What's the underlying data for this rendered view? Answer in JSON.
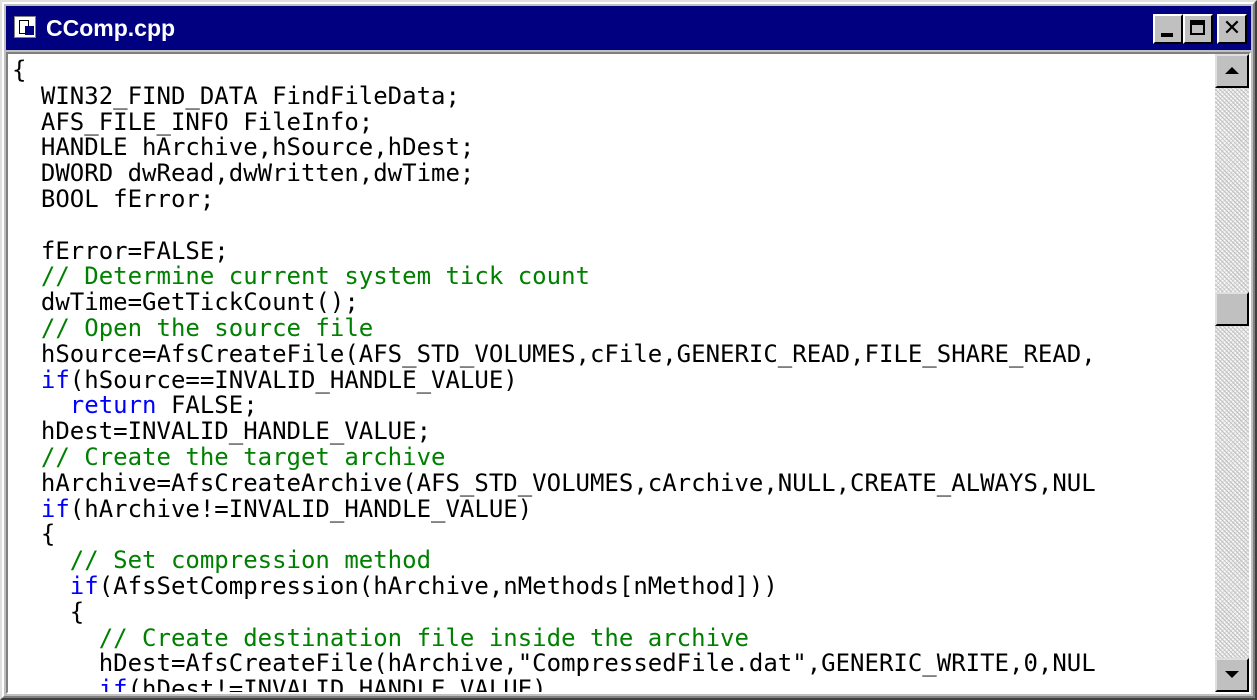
{
  "window": {
    "title": "CComp.cpp",
    "icon": "document-icon",
    "controls": {
      "minimize": "minimize-icon",
      "maximize": "maximize-icon",
      "close": "close-icon",
      "close_glyph": "✕"
    }
  },
  "colors": {
    "titlebar": "#000080",
    "comment": "#008000",
    "keyword": "#0000ff",
    "text": "#000000"
  },
  "editor": {
    "lines": [
      [
        {
          "t": "plain",
          "v": "{"
        }
      ],
      [
        {
          "t": "plain",
          "v": "  WIN32_FIND_DATA FindFileData;"
        }
      ],
      [
        {
          "t": "plain",
          "v": "  AFS_FILE_INFO FileInfo;"
        }
      ],
      [
        {
          "t": "plain",
          "v": "  HANDLE hArchive,hSource,hDest;"
        }
      ],
      [
        {
          "t": "plain",
          "v": "  DWORD dwRead,dwWritten,dwTime;"
        }
      ],
      [
        {
          "t": "plain",
          "v": "  BOOL fError;"
        }
      ],
      [
        {
          "t": "plain",
          "v": ""
        }
      ],
      [
        {
          "t": "plain",
          "v": "  fError=FALSE;"
        }
      ],
      [
        {
          "t": "comment",
          "v": "  // Determine current system tick count"
        }
      ],
      [
        {
          "t": "plain",
          "v": "  dwTime=GetTickCount();"
        }
      ],
      [
        {
          "t": "comment",
          "v": "  // Open the source file"
        }
      ],
      [
        {
          "t": "plain",
          "v": "  hSource=AfsCreateFile(AFS_STD_VOLUMES,cFile,GENERIC_READ,FILE_SHARE_READ,"
        }
      ],
      [
        {
          "t": "keyword",
          "v": "  if"
        },
        {
          "t": "plain",
          "v": "(hSource==INVALID_HANDLE_VALUE)"
        }
      ],
      [
        {
          "t": "keyword",
          "v": "    return"
        },
        {
          "t": "plain",
          "v": " FALSE;"
        }
      ],
      [
        {
          "t": "plain",
          "v": "  hDest=INVALID_HANDLE_VALUE;"
        }
      ],
      [
        {
          "t": "comment",
          "v": "  // Create the target archive"
        }
      ],
      [
        {
          "t": "plain",
          "v": "  hArchive=AfsCreateArchive(AFS_STD_VOLUMES,cArchive,NULL,CREATE_ALWAYS,NUL"
        }
      ],
      [
        {
          "t": "keyword",
          "v": "  if"
        },
        {
          "t": "plain",
          "v": "(hArchive!=INVALID_HANDLE_VALUE)"
        }
      ],
      [
        {
          "t": "plain",
          "v": "  {"
        }
      ],
      [
        {
          "t": "comment",
          "v": "    // Set compression method"
        }
      ],
      [
        {
          "t": "keyword",
          "v": "    if"
        },
        {
          "t": "plain",
          "v": "(AfsSetCompression(hArchive,nMethods[nMethod]))"
        }
      ],
      [
        {
          "t": "plain",
          "v": "    {"
        }
      ],
      [
        {
          "t": "comment",
          "v": "      // Create destination file inside the archive"
        }
      ],
      [
        {
          "t": "plain",
          "v": "      hDest=AfsCreateFile(hArchive,\"CompressedFile.dat\",GENERIC_WRITE,0,NUL"
        }
      ],
      [
        {
          "t": "keyword",
          "v": "      if"
        },
        {
          "t": "plain",
          "v": "(hDest!=INVALID_HANDLE_VALUE)"
        }
      ]
    ]
  },
  "scrollbar": {
    "up_icon": "scroll-up-arrow-icon",
    "down_icon": "scroll-down-arrow-icon",
    "position_fraction": 0.38
  }
}
